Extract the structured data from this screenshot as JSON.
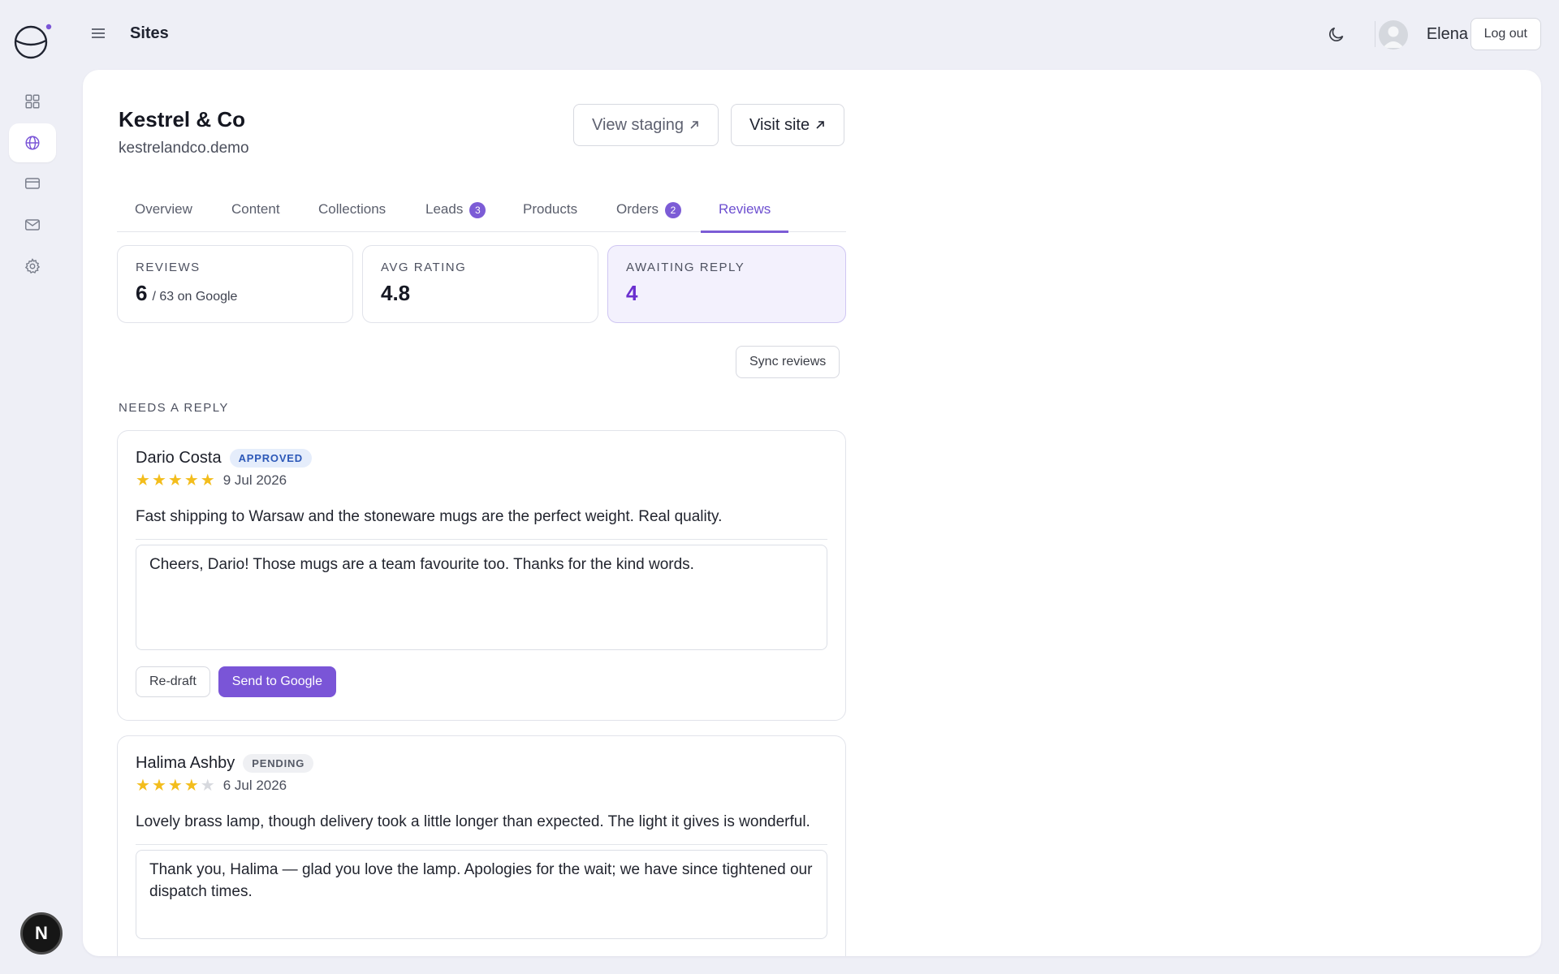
{
  "app": {
    "page_title": "Sites",
    "user_name": "Elena",
    "logout_label": "Log out",
    "rail_badge_letter": "N",
    "brand_color": "#7a55d7"
  },
  "sidebar": {
    "items": [
      {
        "icon": "grid-icon",
        "active": false
      },
      {
        "icon": "globe-icon",
        "active": true
      },
      {
        "icon": "credit-card-icon",
        "active": false
      },
      {
        "icon": "mail-icon",
        "active": false
      },
      {
        "icon": "gear-icon",
        "active": false
      }
    ]
  },
  "site": {
    "name": "Kestrel & Co",
    "domain": "kestrelandco.demo",
    "view_staging_label": "View staging",
    "visit_site_label": "Visit site"
  },
  "tabs": [
    {
      "label": "Overview"
    },
    {
      "label": "Content"
    },
    {
      "label": "Collections"
    },
    {
      "label": "Leads",
      "badge": "3"
    },
    {
      "label": "Products"
    },
    {
      "label": "Orders",
      "badge": "2"
    },
    {
      "label": "Reviews",
      "active": true
    }
  ],
  "stats": [
    {
      "label": "REVIEWS",
      "value": "6",
      "suffix": "/ 63 on Google"
    },
    {
      "label": "AVG RATING",
      "value": "4.8"
    },
    {
      "label": "AWAITING REPLY",
      "value": "4"
    }
  ],
  "sync_label": "Sync reviews",
  "section_label": "NEEDS A REPLY",
  "reviews": [
    {
      "name": "Dario Costa",
      "status": "APPROVED",
      "rating": 5,
      "date": "9 Jul 2026",
      "text": "Fast shipping to Warsaw and the stoneware mugs are the perfect weight. Real quality.",
      "reply": "Cheers, Dario! Those mugs are a team favourite too. Thanks for the kind words.",
      "redraft_label": "Re-draft",
      "send_label": "Send to Google"
    },
    {
      "name": "Halima Ashby",
      "status": "PENDING",
      "rating": 4,
      "date": "6 Jul 2026",
      "text": "Lovely brass lamp, though delivery took a little longer than expected. The light it gives is wonderful.",
      "reply": "Thank you, Halima — glad you love the lamp. Apologies for the wait; we have since tightened our dispatch times."
    }
  ]
}
